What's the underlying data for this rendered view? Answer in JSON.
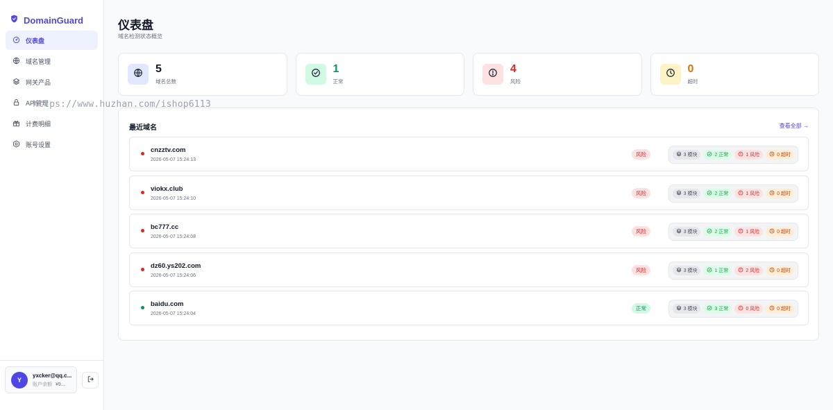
{
  "brand": {
    "name": "DomainGuard",
    "color": "#4f46e5"
  },
  "sidebar": {
    "items": [
      {
        "label": "仪表盘",
        "icon": "dashboard-icon",
        "active": true
      },
      {
        "label": "域名管理",
        "icon": "globe-icon",
        "active": false
      },
      {
        "label": "网关产品",
        "icon": "layers-icon",
        "active": false
      },
      {
        "label": "API管理",
        "icon": "lock-icon",
        "active": false
      },
      {
        "label": "计费明细",
        "icon": "gift-icon",
        "active": false
      },
      {
        "label": "账号设置",
        "icon": "gear-icon",
        "active": false
      }
    ]
  },
  "watermark": "https://www.huzhan.com/ishop6113",
  "user": {
    "initial": "Y",
    "email": "yxcker@qq.c...",
    "balance_label": "账户余额",
    "balance_value": "¥9..."
  },
  "page": {
    "title": "仪表盘",
    "subtitle": "域名检测状态概览"
  },
  "stats": [
    {
      "value": "5",
      "label": "域名总数",
      "icon": "globe-icon",
      "color": "#111827",
      "bg": "#e0e7ff",
      "icon_color": "#1e293b"
    },
    {
      "value": "1",
      "label": "正常",
      "icon": "check-circle-icon",
      "color": "#059669",
      "bg": "#d1fae5",
      "icon_color": "#111827"
    },
    {
      "value": "4",
      "label": "风险",
      "icon": "alert-circle-icon",
      "color": "#dc2626",
      "bg": "#fee2e2",
      "icon_color": "#111827"
    },
    {
      "value": "0",
      "label": "超时",
      "icon": "clock-icon",
      "color": "#d97706",
      "bg": "#fef3c7",
      "icon_color": "#111827"
    }
  ],
  "recent": {
    "title": "最近域名",
    "view_all": "查看全部 →",
    "rows": [
      {
        "domain": "cnzztv.com",
        "time": "2026-05-07 15:24:13",
        "status": "风险",
        "status_type": "risk",
        "modules": "3 模块",
        "ok": "2 正常",
        "risk": "1 风险",
        "timeout": "0 超时"
      },
      {
        "domain": "viokx.club",
        "time": "2026-05-07 15:24:10",
        "status": "风险",
        "status_type": "risk",
        "modules": "3 模块",
        "ok": "2 正常",
        "risk": "1 风险",
        "timeout": "0 超时"
      },
      {
        "domain": "bc777.cc",
        "time": "2026-05-07 15:24:08",
        "status": "风险",
        "status_type": "risk",
        "modules": "3 模块",
        "ok": "2 正常",
        "risk": "1 风险",
        "timeout": "0 超时"
      },
      {
        "domain": "dz60.ys202.com",
        "time": "2026-05-07 15:24:06",
        "status": "风险",
        "status_type": "risk",
        "modules": "3 模块",
        "ok": "1 正常",
        "risk": "2 风险",
        "timeout": "0 超时"
      },
      {
        "domain": "baidu.com",
        "time": "2026-05-07 15:24:04",
        "status": "正常",
        "status_type": "ok",
        "modules": "3 模块",
        "ok": "3 正常",
        "risk": "0 风险",
        "timeout": "0 超时"
      }
    ]
  },
  "colors": {
    "risk_dot": "#dc2626",
    "ok_dot": "#059669",
    "risk_badge_bg": "#fee2e2",
    "risk_badge_text": "#dc2626",
    "ok_badge_bg": "#d1fae5",
    "ok_badge_text": "#059669"
  }
}
